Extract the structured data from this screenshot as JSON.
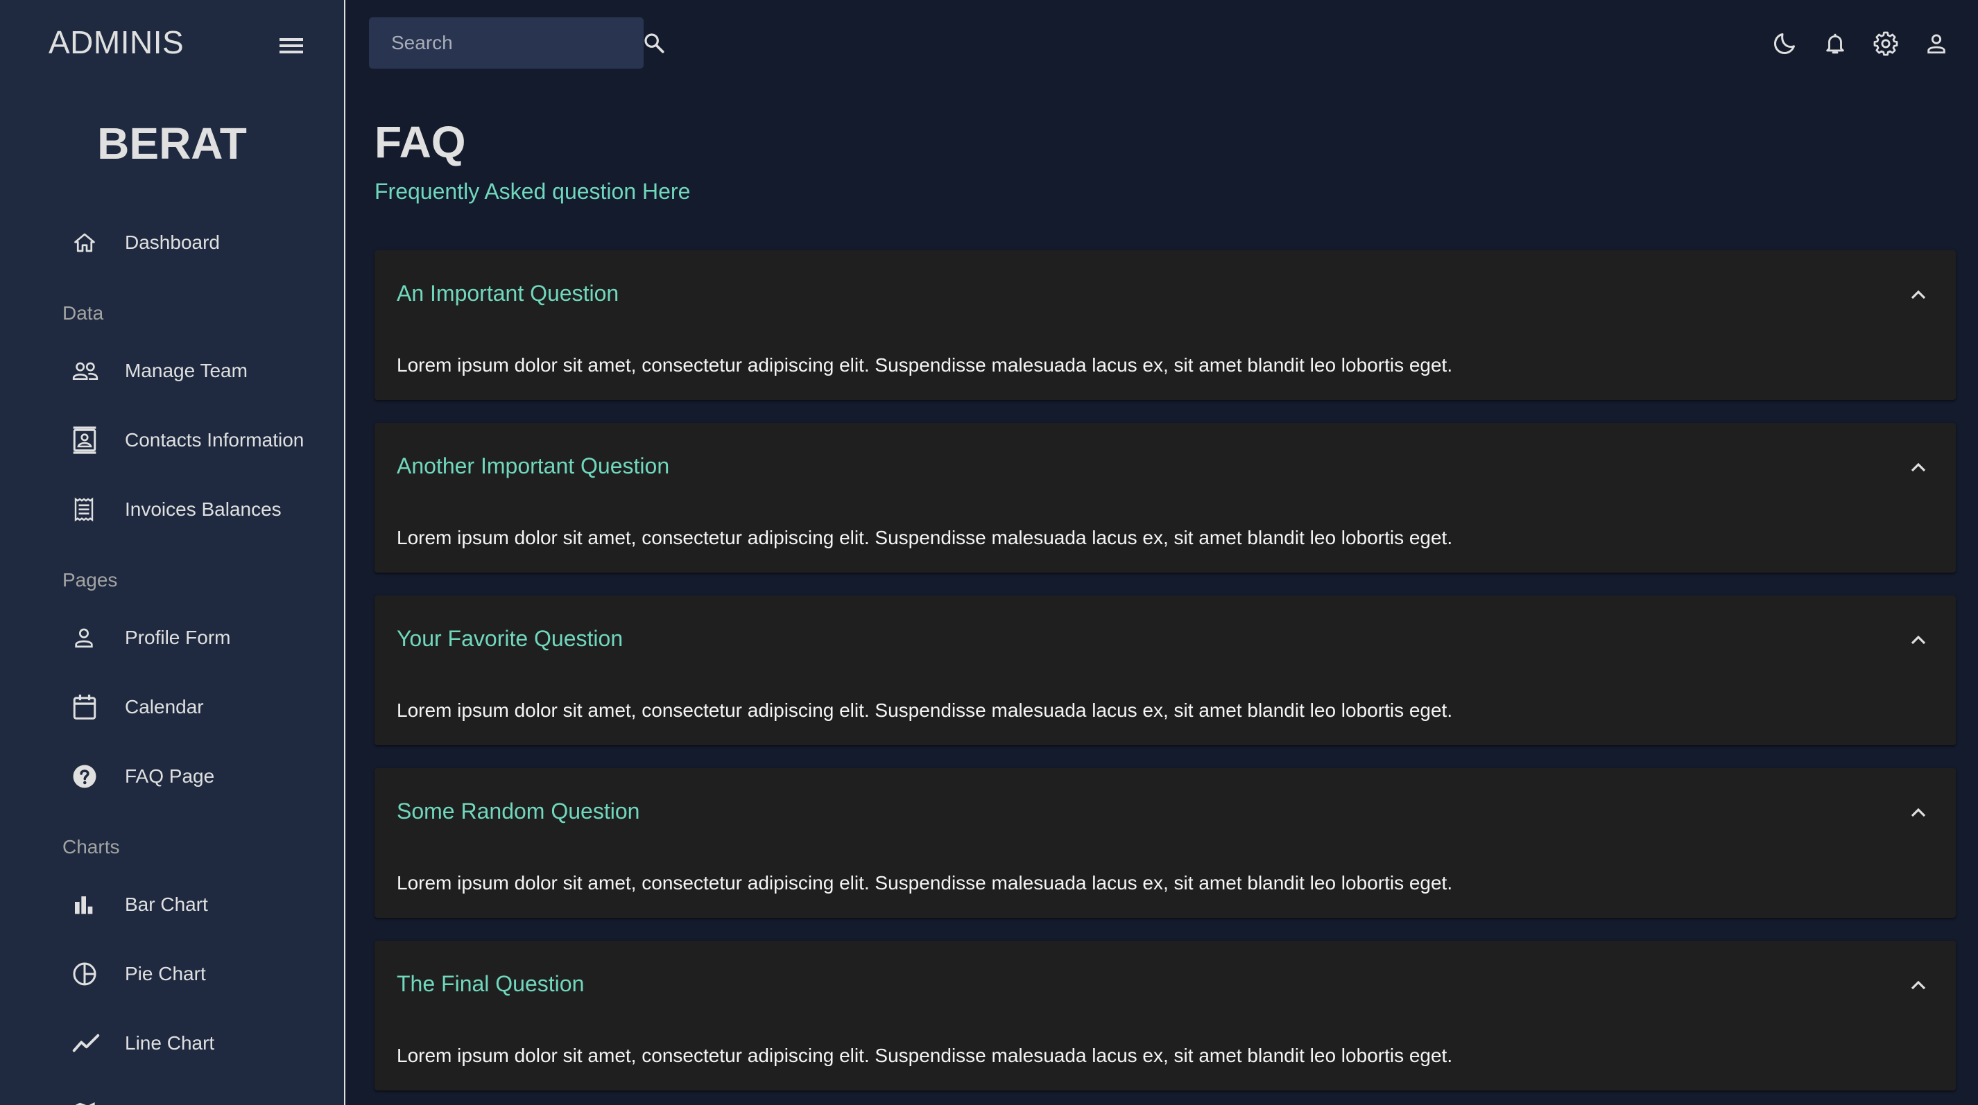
{
  "app": {
    "brand": "ADMINIS",
    "user_name": "BERAT"
  },
  "colors": {
    "accent": "#70d8bd",
    "background": "#141b2d",
    "sidebar": "#1f2a40",
    "card": "#1f1f1f",
    "search_bg": "#293450"
  },
  "search": {
    "placeholder": "Search"
  },
  "topbar": {
    "icons": [
      "moon-icon",
      "bell-icon",
      "gear-icon",
      "person-icon"
    ]
  },
  "sidebar": {
    "toggle_icon": "menu-icon",
    "items": [
      {
        "label": "Dashboard",
        "icon": "home-icon"
      },
      {
        "label": "Manage Team",
        "icon": "people-icon"
      },
      {
        "label": "Contacts Information",
        "icon": "contacts-icon"
      },
      {
        "label": "Invoices Balances",
        "icon": "receipt-icon"
      },
      {
        "label": "Profile Form",
        "icon": "person-icon"
      },
      {
        "label": "Calendar",
        "icon": "calendar-icon"
      },
      {
        "label": "FAQ Page",
        "icon": "help-circle-icon"
      },
      {
        "label": "Bar Chart",
        "icon": "bar-chart-icon"
      },
      {
        "label": "Pie Chart",
        "icon": "pie-chart-icon"
      },
      {
        "label": "Line Chart",
        "icon": "line-chart-icon"
      }
    ],
    "sections": [
      "Data",
      "Pages",
      "Charts"
    ]
  },
  "page": {
    "title": "FAQ",
    "subtitle": "Frequently Asked question Here"
  },
  "faq": [
    {
      "question": "An Important Question",
      "answer": "Lorem ipsum dolor sit amet, consectetur adipiscing elit. Suspendisse malesuada lacus ex, sit amet blandit leo lobortis eget.",
      "expanded": true
    },
    {
      "question": "Another Important Question",
      "answer": "Lorem ipsum dolor sit amet, consectetur adipiscing elit. Suspendisse malesuada lacus ex, sit amet blandit leo lobortis eget.",
      "expanded": true
    },
    {
      "question": "Your Favorite Question",
      "answer": "Lorem ipsum dolor sit amet, consectetur adipiscing elit. Suspendisse malesuada lacus ex, sit amet blandit leo lobortis eget.",
      "expanded": true
    },
    {
      "question": "Some Random Question",
      "answer": "Lorem ipsum dolor sit amet, consectetur adipiscing elit. Suspendisse malesuada lacus ex, sit amet blandit leo lobortis eget.",
      "expanded": true
    },
    {
      "question": "The Final Question",
      "answer": "Lorem ipsum dolor sit amet, consectetur adipiscing elit. Suspendisse malesuada lacus ex, sit amet blandit leo lobortis eget.",
      "expanded": true
    }
  ]
}
